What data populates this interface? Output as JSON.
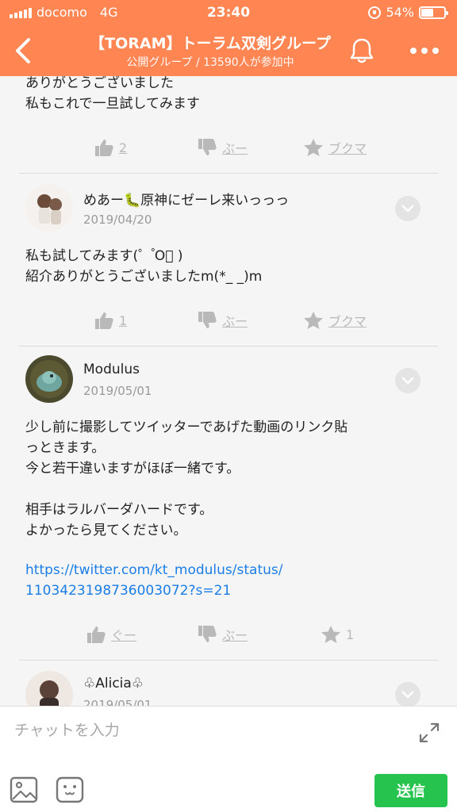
{
  "status_bar": {
    "carrier": "docomo",
    "network": "4G",
    "time": "23:40",
    "battery": "54%",
    "battery_level": 0.54
  },
  "header": {
    "title": "【TORAM】トーラム双剣グループ",
    "subtitle": "公開グループ / 13590人が参加中",
    "bg_color": "#ff8552"
  },
  "posts": [
    {
      "body": "ありがとうございました\n私もこれで一旦試してみます",
      "actions": {
        "like": "2",
        "dislike": "ぶー",
        "bookmark": "ブクマ"
      }
    },
    {
      "author": "めあー🐛原神にゼーレ来いっっっ",
      "date": "2019/04/20",
      "body": "私も試してみます(゜ ゚O゚ )\n紹介ありがとうございましたm(*_ _)m",
      "actions": {
        "like": "1",
        "dislike": "ぶー",
        "bookmark": "ブクマ"
      }
    },
    {
      "author": "Modulus",
      "date": "2019/05/01",
      "body": "少し前に撮影してツイッターであげた動画のリンク貼\nっときます。\n今と若干違いますがほぼ一緒です。\n\n相手はラルバーダハードです。\nよかったら見てください。",
      "link": "https://twitter.com/kt_modulus/status/\n1103423198736003072?s=21",
      "actions": {
        "like": "ぐー",
        "dislike": "ぶー",
        "bookmark": "1"
      }
    },
    {
      "author": "♧Alicia♧",
      "date": "2019/05/01"
    }
  ],
  "composer": {
    "placeholder": "チャットを入力",
    "send_label": "送信"
  },
  "colors": {
    "accent": "#ff8552",
    "send": "#27c34f",
    "link": "#1a7ee6",
    "muted_icon": "#b9b9b9"
  }
}
